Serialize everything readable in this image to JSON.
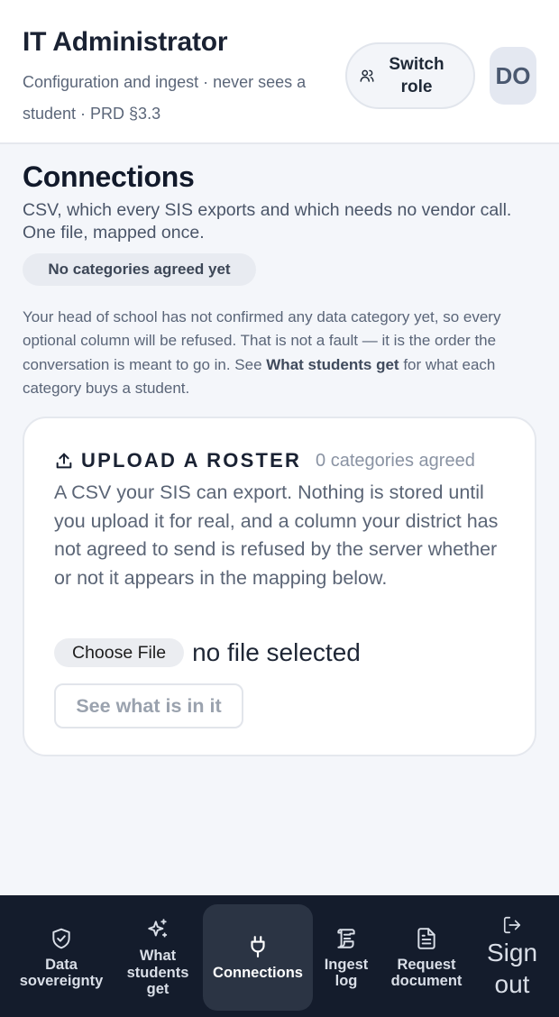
{
  "header": {
    "role_title": "IT Administrator",
    "role_subtitle": "Configuration and ingest · never sees a student · PRD §3.3",
    "switch_role_label": "Switch role",
    "avatar_initials": "DO"
  },
  "connections": {
    "title": "Connections",
    "description": "CSV, which every SIS exports and which needs no vendor call. One file, mapped once.",
    "status_badge": "No categories agreed yet",
    "notice_prefix": "Your head of school has not confirmed any data category yet, so every optional column will be refused. That is not a fault — it is the order the conversation is meant to go in. See ",
    "notice_link": "What students get",
    "notice_suffix": " for what each category buys a student."
  },
  "upload_card": {
    "icon": "upload-icon",
    "title": "UPLOAD A ROSTER",
    "category_count": "0 categories agreed",
    "body": "A CSV your SIS can export. Nothing is stored until you upload it for real, and a column your district has not agreed to send is refused by the server whether or not it appears in the mapping below.",
    "choose_file_label": "Choose File",
    "file_status": "no file selected",
    "inspect_label": "See what is in it"
  },
  "nav": {
    "items": [
      {
        "label_line1": "Data",
        "label_line2": "sovereignty",
        "icon": "shield-check-icon"
      },
      {
        "label_line1": "What",
        "label_line2": "students",
        "label_line3": "get",
        "icon": "sparkles-icon"
      },
      {
        "label_line1": "Connections",
        "icon": "plug-icon",
        "active": true
      },
      {
        "label_line1": "Ingest",
        "label_line2": "log",
        "icon": "scroll-icon"
      },
      {
        "label_line1": "Request",
        "label_line2": "document",
        "icon": "document-icon"
      },
      {
        "label_line1": "Sign",
        "label_line2": "out",
        "icon": "sign-out-icon"
      }
    ]
  },
  "colors": {
    "nav_background": "#141c2c",
    "nav_active": "#2b3444",
    "page_background": "#f4f6fa",
    "heading": "#121a2b"
  }
}
